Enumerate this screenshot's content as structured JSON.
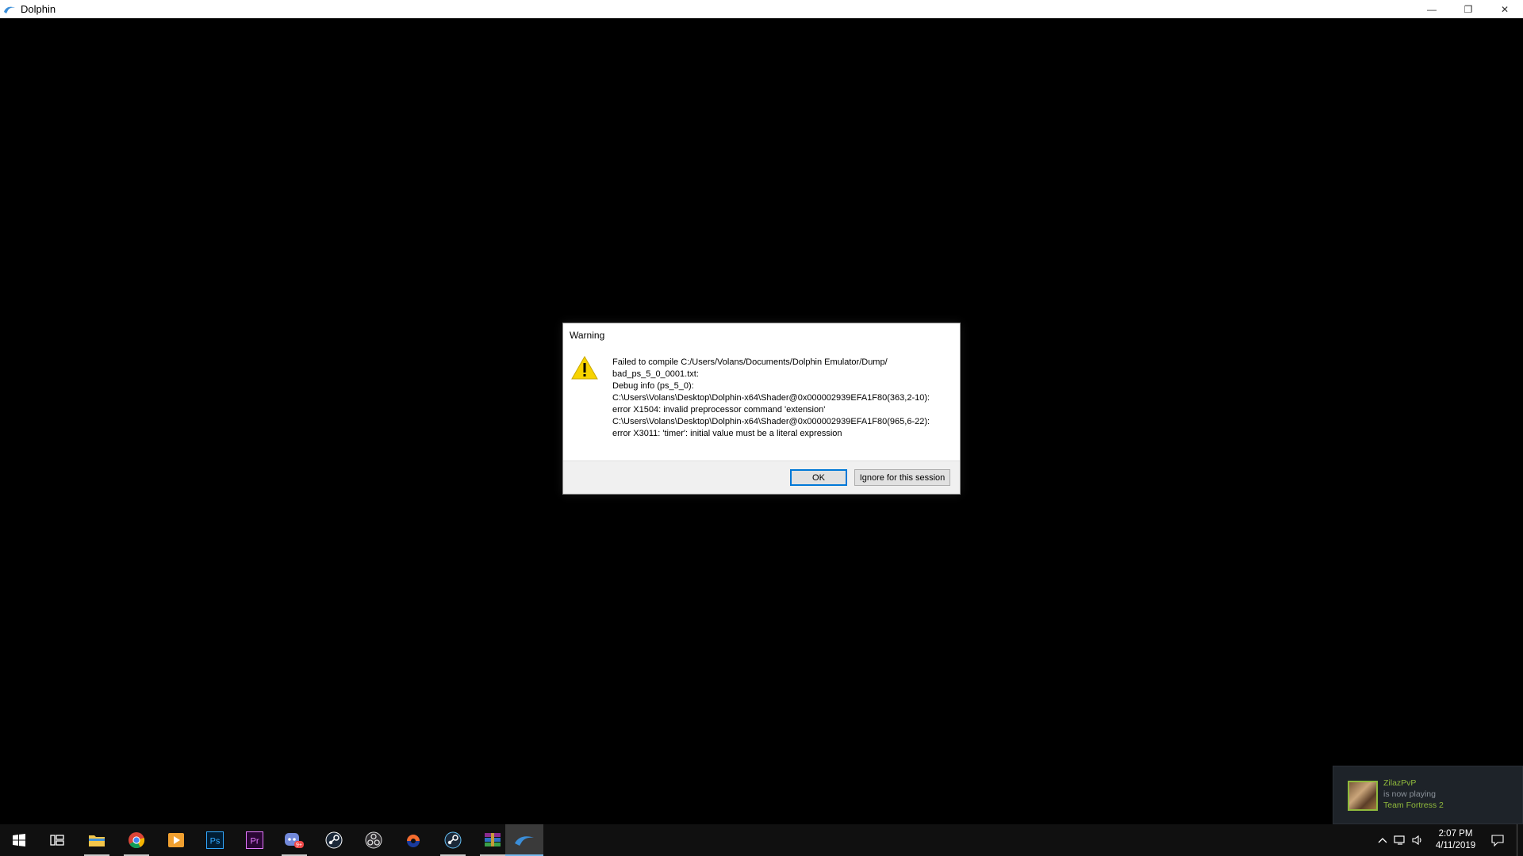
{
  "window": {
    "title": "Dolphin",
    "minimize_glyph": "—",
    "restore_glyph": "❐",
    "close_glyph": "✕"
  },
  "dialog": {
    "title": "Warning",
    "icon": "warning-icon",
    "message_lines": [
      "Failed to compile C:/Users/Volans/Documents/Dolphin Emulator/Dump/",
      "bad_ps_5_0_0001.txt:",
      "Debug info (ps_5_0):",
      "C:\\Users\\Volans\\Desktop\\Dolphin-x64\\Shader@0x000002939EFA1F80(363,2-10):",
      "error X1504: invalid preprocessor command 'extension'",
      "C:\\Users\\Volans\\Desktop\\Dolphin-x64\\Shader@0x000002939EFA1F80(965,6-22):",
      "error X3011: 'timer': initial value must be a literal expression"
    ],
    "ok_label": "OK",
    "ignore_label": "Ignore for this session"
  },
  "notification": {
    "user": "ZilazPvP",
    "status": "is now playing",
    "game": "Team Fortress 2"
  },
  "taskbar": {
    "icons": [
      "windows-start-icon",
      "task-view-icon",
      "file-explorer-icon",
      "chrome-icon",
      "media-player-icon",
      "photoshop-icon",
      "premiere-icon",
      "discord-icon",
      "steam-icon",
      "obs-icon",
      "origin-icon",
      "steam-icon",
      "winrar-icon",
      "dolphin-icon"
    ],
    "ps_label": "Ps",
    "pr_label": "Pr",
    "discord_badge": "9+",
    "clock_time": "2:07 PM",
    "clock_date": "4/11/2019"
  },
  "colors": {
    "accent": "#0078d7",
    "steam_green": "#90ba3c",
    "taskbar": "#101010"
  }
}
